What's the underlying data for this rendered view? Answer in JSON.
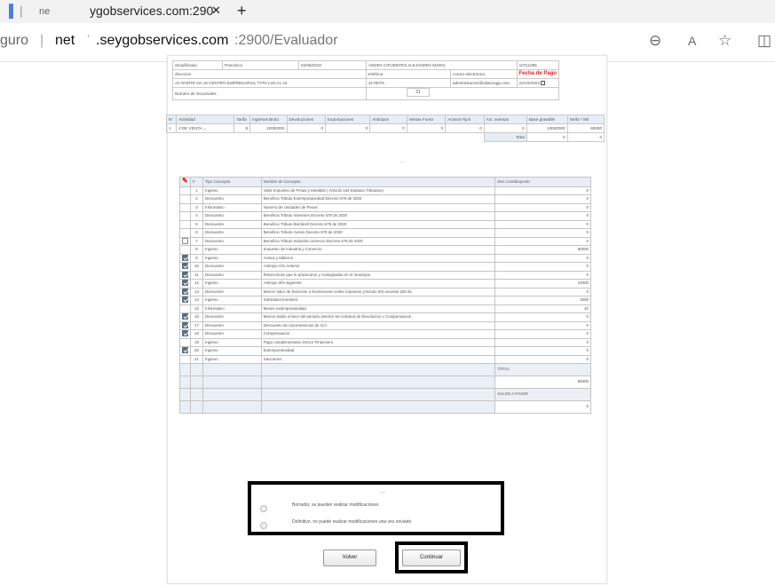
{
  "browser": {
    "tab1_label": "ne",
    "tab2_label": "ygobservices.com:290",
    "tab_close": "✕",
    "new_tab": "+",
    "addr_secure": "guro",
    "addr_sep": "|",
    "addr_net": "net",
    "addr_host": ".seygobservices.com",
    "addr_path": ":2900/Evaluador",
    "zoom_icon": "⊖",
    "read_icon": "A",
    "fav_icon": "☆",
    "split_icon": "◫"
  },
  "header": {
    "r1": [
      "Simplificado",
      "Prancisco",
      "04/05/2010",
      "ANDRA CIFUENTES ALEJANDRA MARIA",
      "10711065"
    ],
    "r2": [
      "direccion",
      "telefono",
      "correo electronico"
    ],
    "fecha_pago": "Fecha de Pago",
    "r3": [
      "AV NORTE NA 19 CENTRO EMPRESARIAL TYPA LOCAL 10",
      "3176075",
      "administracion@alianzagp.com",
      "22/10/2023"
    ],
    "sucursales_label": "Numero de Sucursales",
    "sucursales_value": "21"
  },
  "activity": {
    "headers": [
      "N°",
      "Actividad",
      "Tarifa",
      "Ingresos Bruto",
      "Devoluciones",
      "Exportaciones",
      "Anticipos",
      "Ventas Fuera",
      "Activos Fijos",
      "Act. exentas",
      "Base gravable",
      "Tarifa * Mil"
    ],
    "row": [
      "1",
      "2 DE VENTA",
      "8",
      "10000000",
      "0",
      "0",
      "0",
      "0",
      "0",
      "0",
      "10000000",
      "80000"
    ],
    "total_label": "Total",
    "total_values": [
      "0",
      "0"
    ]
  },
  "divider": "...",
  "conceptos": {
    "headers": [
      "#",
      "Tipo Concepto",
      "Nombre de Concepto",
      "Dec.Contribuyente"
    ],
    "rows": [
      {
        "n": "1",
        "tipo": "Ingreso",
        "nombre": "Valor Impuesto de Pesas y Medidas ( Articulo 164 Estatuto Tributario)",
        "val": "0",
        "chk": "none"
      },
      {
        "n": "2",
        "tipo": "Descuento",
        "nombre": "Beneficio Tributo Extemporaneidad Decreto 678 de 2020",
        "val": "0",
        "chk": "none"
      },
      {
        "n": "3",
        "tipo": "Informativo",
        "nombre": "Numero de Unidades de Pesas",
        "val": "0",
        "chk": "none"
      },
      {
        "n": "4",
        "tipo": "Descuento",
        "nombre": "Beneficio Tributo Intereses Decreto 678 de 2020",
        "val": "0",
        "chk": "none"
      },
      {
        "n": "5",
        "tipo": "Descuento",
        "nombre": "Beneficio Tributo Bomberil Decreto 678 de 2020",
        "val": "0",
        "chk": "none"
      },
      {
        "n": "6",
        "tipo": "Descuento",
        "nombre": "Beneficio Tributo Avisos Decreto 678 de 2020",
        "val": "0",
        "chk": "none"
      },
      {
        "n": "7",
        "tipo": "Descuento",
        "nombre": "Beneficio Tributo Industria comercio Decreto 678 de 2020",
        "val": "0",
        "chk": "off"
      },
      {
        "n": "8",
        "tipo": "Ingreso",
        "nombre": "Impuesto de Industria y Comercio",
        "val": "80000",
        "chk": "none"
      },
      {
        "n": "9",
        "tipo": "Ingreso",
        "nombre": "Avisos y tableros",
        "val": "0",
        "chk": "on"
      },
      {
        "n": "10",
        "tipo": "Descuento",
        "nombre": "Anticipo Año Anterior",
        "val": "0",
        "chk": "on"
      },
      {
        "n": "11",
        "tipo": "Descuento",
        "nombre": "Retenciones que le practicaron y consignadas en el municipio",
        "val": "0",
        "chk": "on"
      },
      {
        "n": "12",
        "tipo": "Ingreso",
        "nombre": "Anticipo año siguiente",
        "val": "24000",
        "chk": "on"
      },
      {
        "n": "13",
        "tipo": "Descuento",
        "nombre": "Menos Valor de Exención o Exoneracion sobre Impuesto (Articulo 60) acuerdo 028 de",
        "val": "0",
        "chk": "on"
      },
      {
        "n": "14",
        "tipo": "Ingreso",
        "nombre": "Sobretasa bomberil",
        "val": "2000",
        "chk": "on"
      },
      {
        "n": "15",
        "tipo": "Informativo",
        "nombre": "Meses extemporaneidad",
        "val": "42",
        "chk": "none"
      },
      {
        "n": "16",
        "tipo": "Descuento",
        "nombre": "Menos Saldo a favor del periodo anterior sin solicitud de Devolucion o Compensacion",
        "val": "0",
        "chk": "on"
      },
      {
        "n": "17",
        "tipo": "Descuento",
        "nombre": "Descuento de Autorretencion de ICA",
        "val": "0",
        "chk": "on"
      },
      {
        "n": "18",
        "tipo": "Descuento",
        "nombre": "Compensacion",
        "val": "0",
        "chk": "on"
      },
      {
        "n": "19",
        "tipo": "Ingreso",
        "nombre": "Pago complementario Sector Financiero",
        "val": "0",
        "chk": "none"
      },
      {
        "n": "20",
        "tipo": "Ingreso",
        "nombre": "Extemporaneidad",
        "val": "0",
        "chk": "on"
      },
      {
        "n": "21",
        "tipo": "Ingreso",
        "nombre": "Sanciones",
        "val": "0",
        "chk": "none"
      }
    ],
    "total_label": "TOTAL",
    "total_value": "85000",
    "saldo_label": "SALDO A FAVOR",
    "saldo_value": "0"
  },
  "options": {
    "dash": "—",
    "borrador": "Borrador, se pueden realizar modificaciones",
    "definitivo": "Definitivo, no puede realizar modificaciones una vez enviado"
  },
  "buttons": {
    "volver": "Volver",
    "continuar": "Continuar"
  }
}
